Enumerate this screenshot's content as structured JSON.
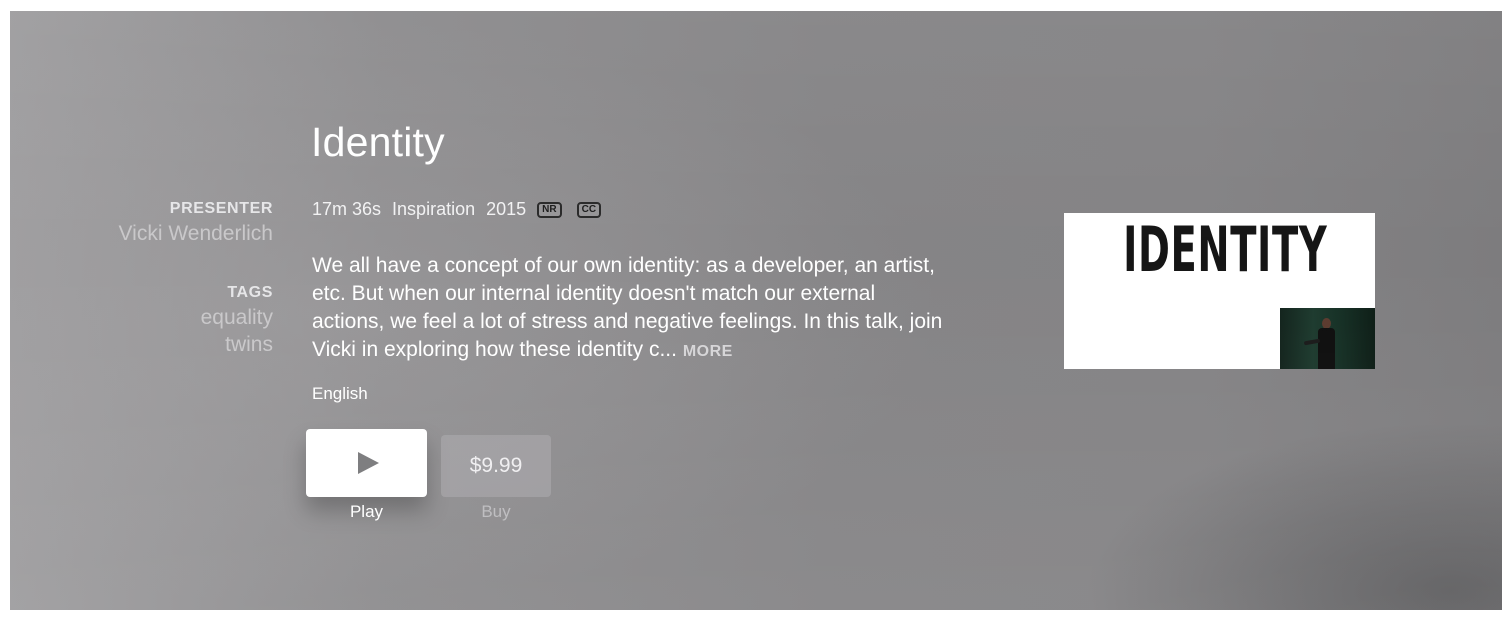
{
  "item": {
    "title": "Identity",
    "presenter_label": "PRESENTER",
    "presenter_name": "Vicki Wenderlich",
    "tags_label": "TAGS",
    "tags": [
      "equality",
      "twins"
    ],
    "duration": "17m 36s",
    "category": "Inspiration",
    "year": "2015",
    "rating_badge": "NR",
    "cc_badge": "CC",
    "description": "We all have a concept of our own identity: as a developer, an artist, etc. But when our internal identity doesn't match our external actions, we feel a lot of stress and negative feelings. In this talk, join Vicki in exploring how these identity c...",
    "more_label": "MORE",
    "language": "English",
    "thumbnail_text": "IDENTITY"
  },
  "actions": {
    "play_icon": "play-icon",
    "play_label": "Play",
    "buy_price": "$9.99",
    "buy_label": "Buy"
  }
}
